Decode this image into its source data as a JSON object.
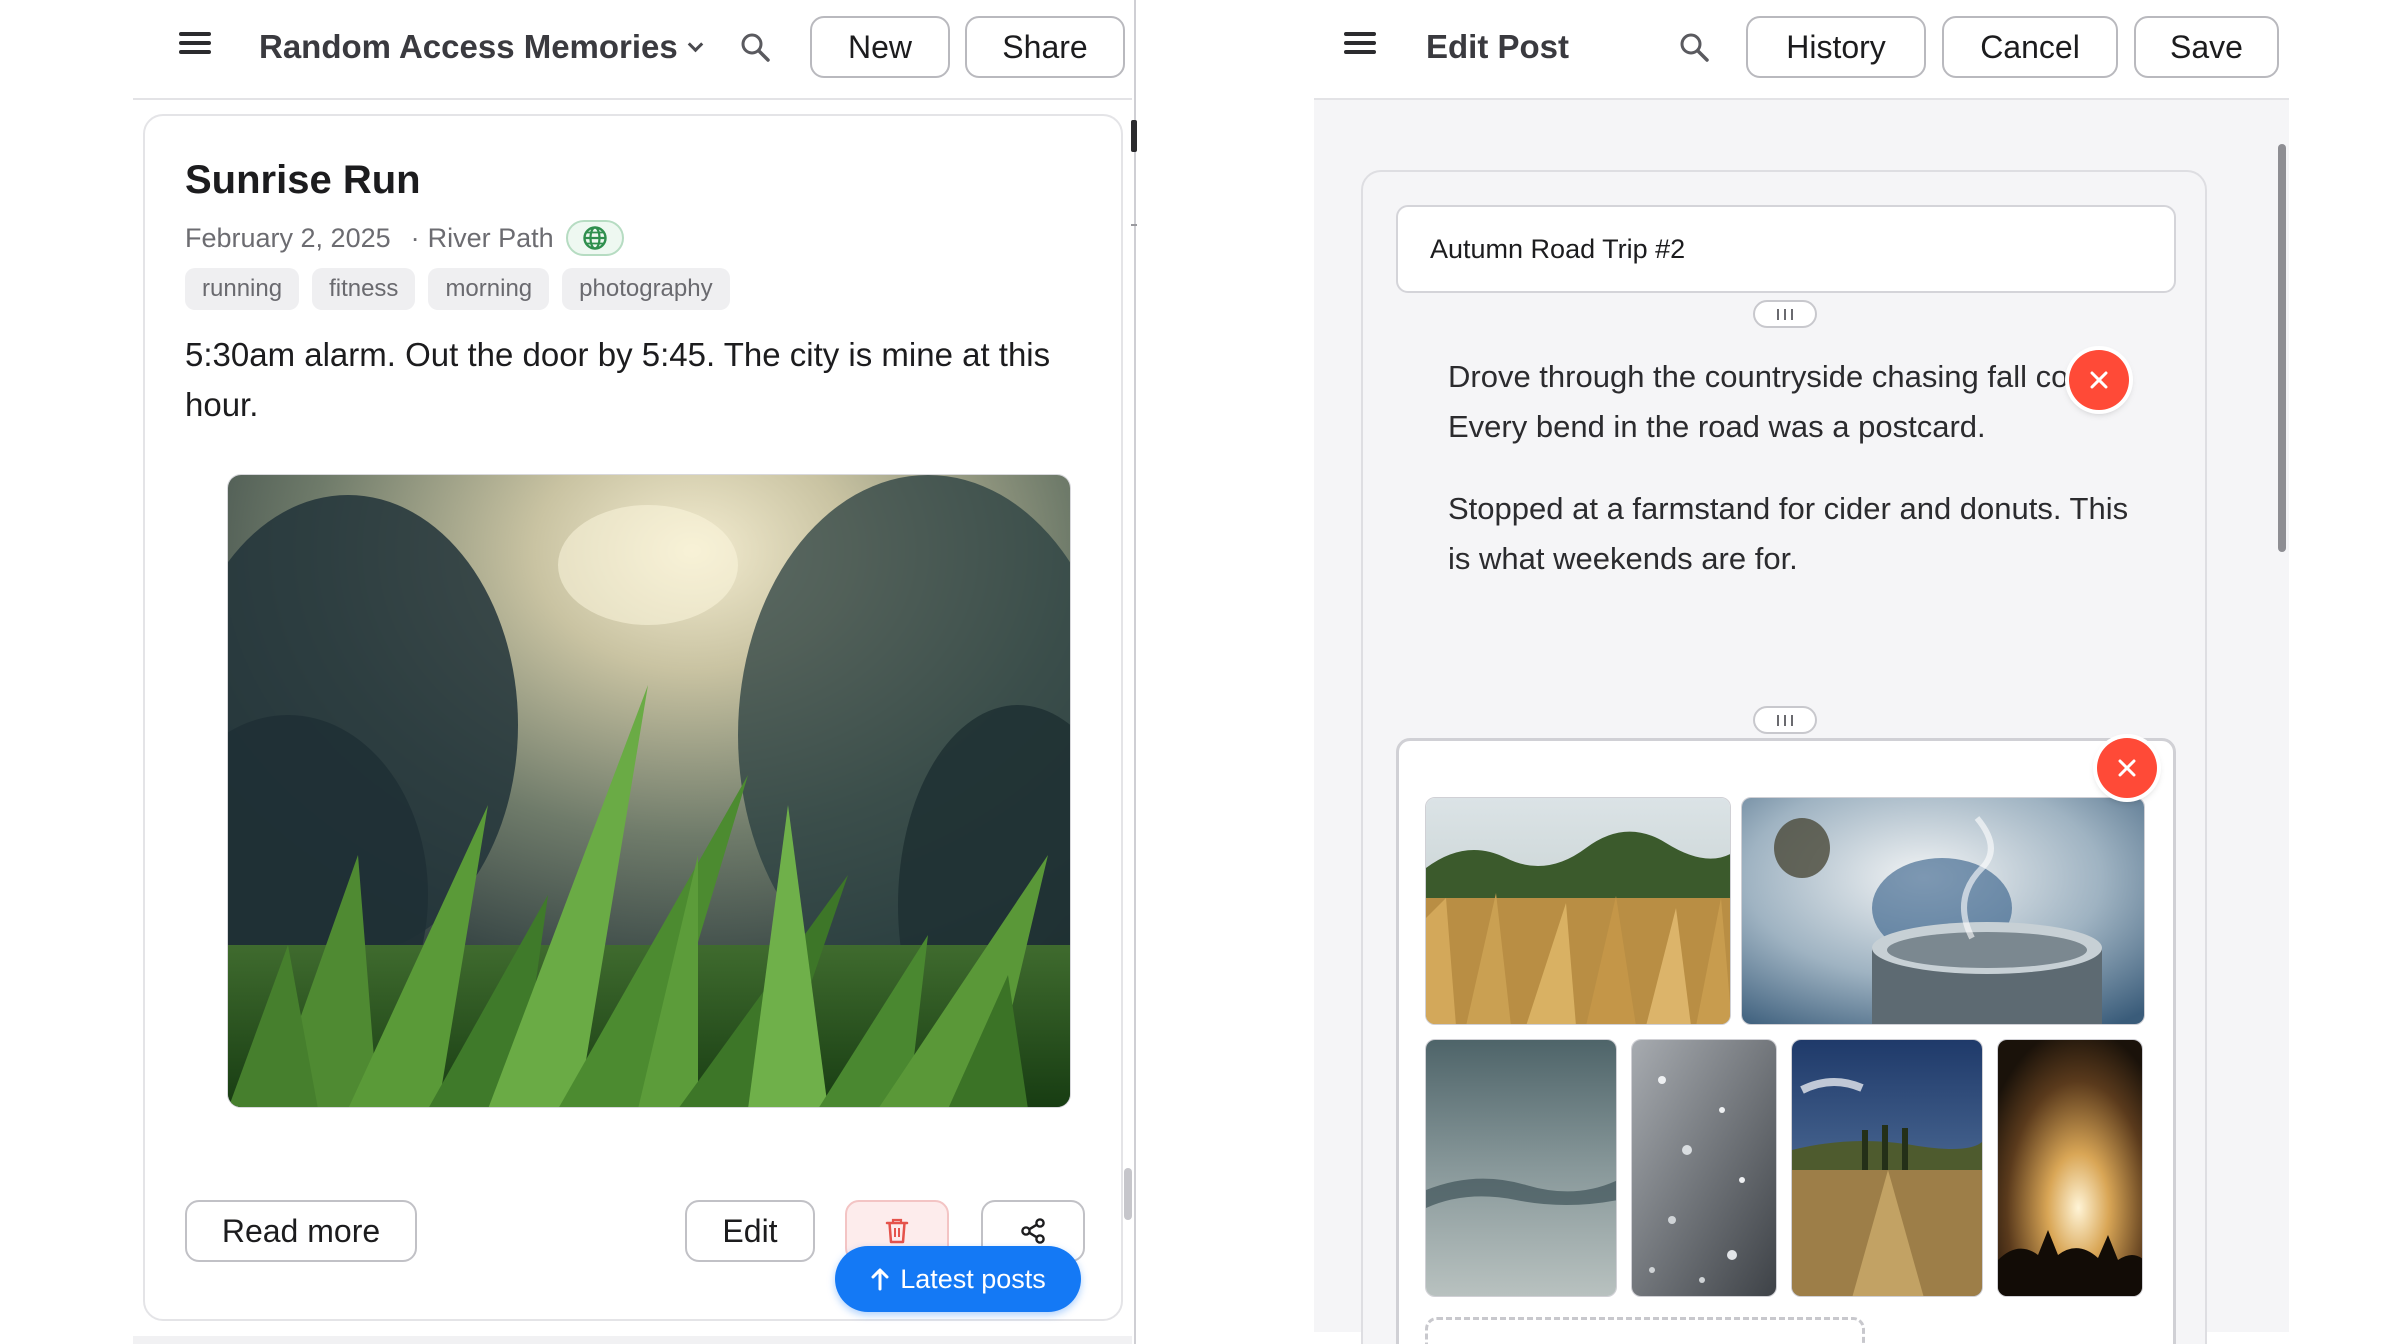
{
  "left": {
    "header": {
      "blog_title": "Random Access Memories",
      "new_label": "New",
      "share_label": "Share"
    },
    "post": {
      "title": "Sunrise Run",
      "date": "February 2, 2025",
      "location": "River Path",
      "tags": [
        "running",
        "fitness",
        "morning",
        "photography"
      ],
      "body": "5:30am alarm. Out the door by 5:45. The city is mine at this hour.",
      "image_alt": "grass-at-sunrise-photo"
    },
    "actions": {
      "read_more_label": "Read more",
      "edit_label": "Edit",
      "latest_posts_label": "Latest posts"
    }
  },
  "right": {
    "header": {
      "title": "Edit Post",
      "history_label": "History",
      "cancel_label": "Cancel",
      "save_label": "Save"
    },
    "editor": {
      "title_value": "Autumn Road Trip #2",
      "paragraphs": [
        "Drove through the countryside chasing fall colors. Every bend in the road was a postcard.",
        "Stopped at a farmstand for cider and donuts. This is what weekends are for."
      ],
      "gallery_count": 6
    }
  },
  "colors": {
    "accent_blue": "#1479f5",
    "remove_red": "#ff4a37",
    "delete_red": "#e5534b",
    "globe_green": "#2f8f4e"
  },
  "icons": [
    "hamburger-icon",
    "chevron-down-icon",
    "search-icon",
    "globe-icon",
    "trash-icon",
    "share-icon",
    "arrow-up-icon",
    "close-icon",
    "drag-handle-icon"
  ]
}
